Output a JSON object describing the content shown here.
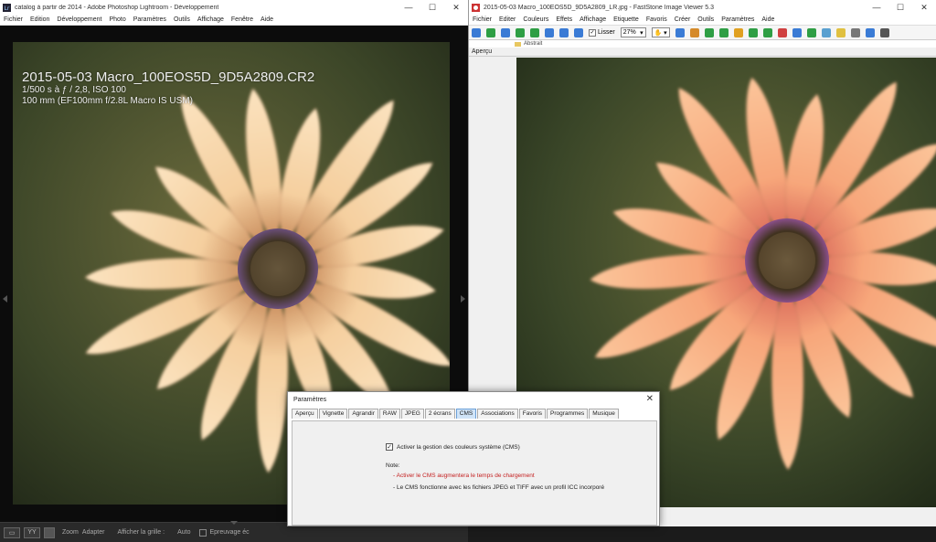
{
  "lightroom": {
    "title": "catalog à partir de 2014 - Adobe Photoshop Lightroom - Développement",
    "menu": [
      "Fichier",
      "Edition",
      "Développement",
      "Photo",
      "Paramètres",
      "Outils",
      "Affichage",
      "Fenêtre",
      "Aide"
    ],
    "info": {
      "filename": "2015-05-03 Macro_100EOS5D_9D5A2809.CR2",
      "exposure": "1/500 s à ƒ / 2,8, ISO 100",
      "lens": "100 mm (EF100mm f/2.8L Macro IS USM)"
    },
    "toolbar": {
      "zoom_label": "Zoom",
      "zoom_value": "Adapter",
      "grid_label": "Afficher la grille :",
      "auto_label": "Auto",
      "soft_proof_label": "Epreuvage éc"
    }
  },
  "faststone": {
    "title": "2015-05-03 Macro_100EOS5D_9D5A2809_LR.jpg - FastStone Image Viewer 5.3",
    "menu": [
      "Fichier",
      "Editer",
      "Couleurs",
      "Effets",
      "Affichage",
      "Etiquette",
      "Favoris",
      "Créer",
      "Outils",
      "Paramètres",
      "Aide"
    ],
    "toolbar": {
      "smooth_label": "Lisser",
      "zoom_value": "27%"
    },
    "tree_folder": "Abstrait",
    "preview_label": "Aperçu",
    "icon_colors": [
      "#3a7bd5",
      "#2e9e44",
      "#3a7bd5",
      "#2e9e44",
      "#2e9e44",
      "#3a7bd5",
      "#3a7bd5",
      "#3a7bd5",
      "#3a7bd5",
      "#d58a2a",
      "#2e9e44",
      "#2e9e44",
      "#e0a020",
      "#2e9e44",
      "#2e9e44",
      "#d04040",
      "#3a7bd5",
      "#2e9e44",
      "#5aa0d0",
      "#e0c040",
      "#777777",
      "#3a7bd5",
      "#555555"
    ]
  },
  "dialog": {
    "title": "Paramètres",
    "tabs": [
      "Aperçu",
      "Vignette",
      "Agrandir",
      "RAW",
      "JPEG",
      "2 écrans",
      "CMS",
      "Associations",
      "Favoris",
      "Programmes",
      "Musique"
    ],
    "active_tab": "CMS",
    "cms_checkbox_label": "Activer la gestion des couleurs système (CMS)",
    "cms_checked": true,
    "note_label": "Note:",
    "note_red": "- Activer le CMS augmentera le temps de chargement",
    "note_black": "- Le CMS fonctionne avec les fichiers JPEG et TIFF avec un profil ICC incorporé",
    "close_symbol": "✕"
  },
  "colors": {
    "petal_light": "#f6d2a8",
    "petal_salmon": "#f6a575",
    "center": "#4a3a25",
    "background_green": "#3e4a2a",
    "red_note": "#c42020"
  }
}
